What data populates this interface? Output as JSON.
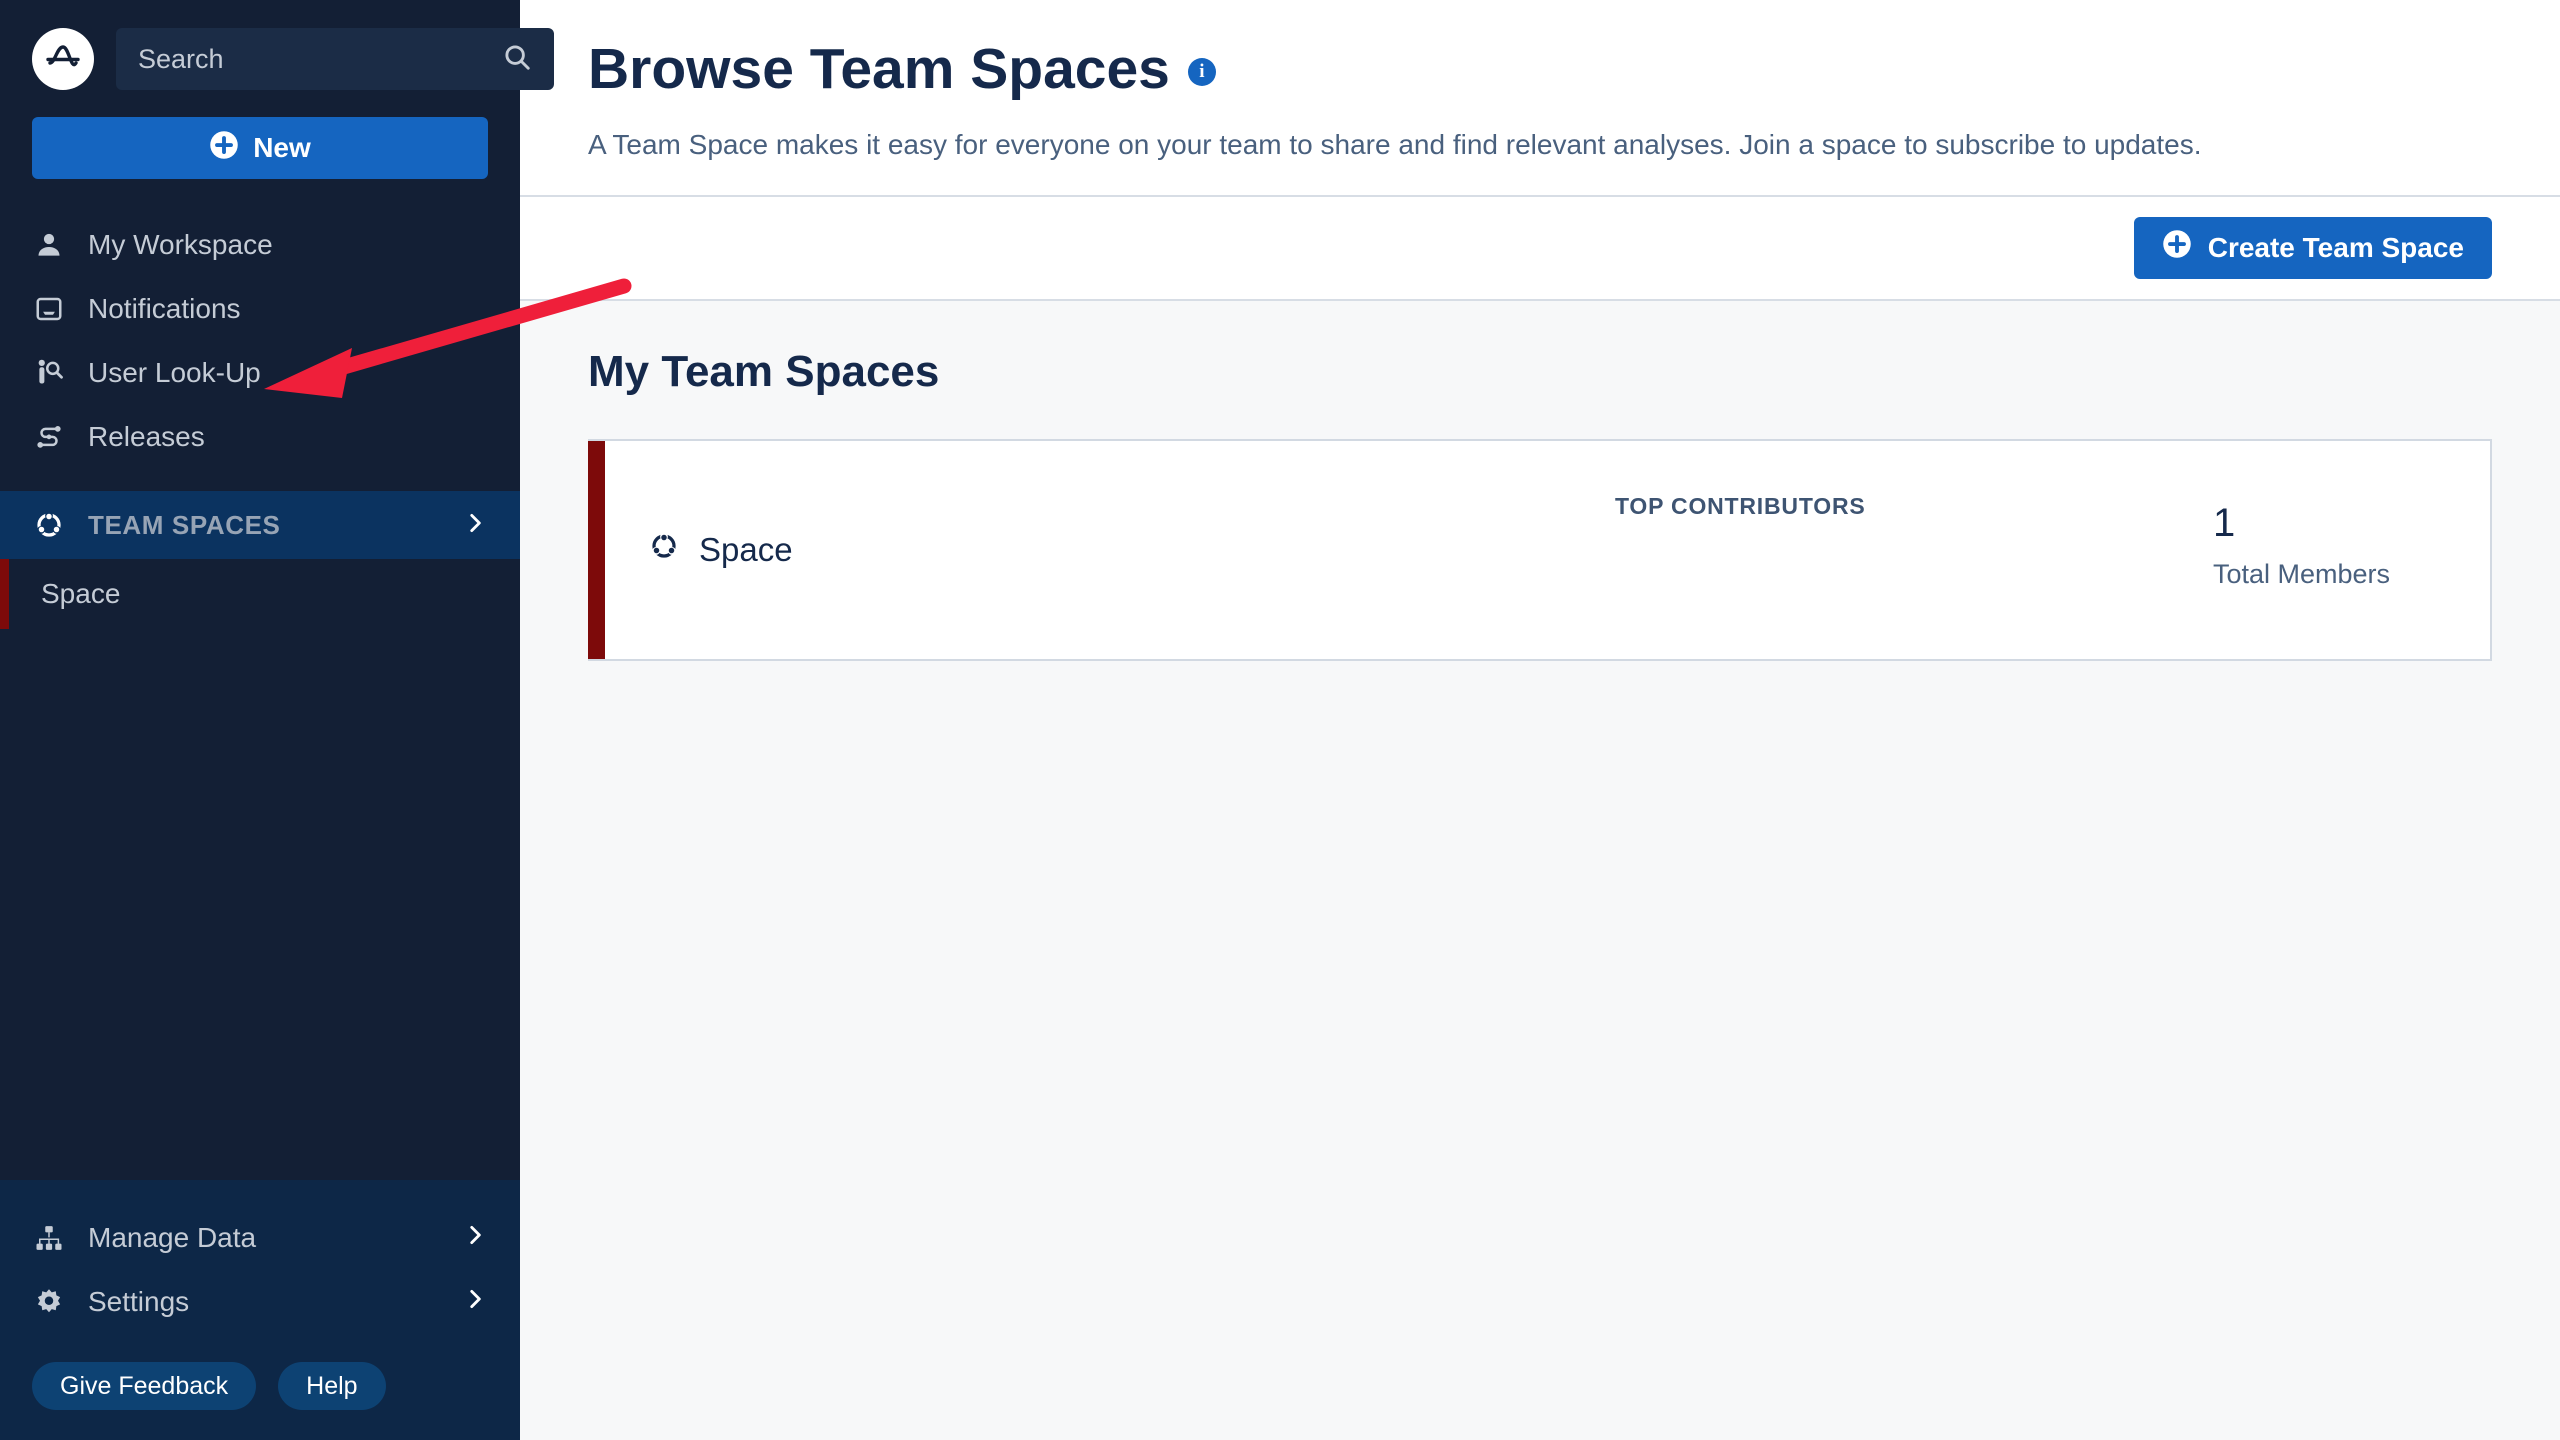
{
  "sidebar": {
    "logo_icon": "amplitude-logo-icon",
    "search": {
      "placeholder": "Search",
      "value": "",
      "icon": "search-icon"
    },
    "new_button": {
      "label": "New",
      "icon": "plus-circle-icon"
    },
    "nav_items": [
      {
        "label": "My Workspace",
        "icon": "person-icon"
      },
      {
        "label": "Notifications",
        "icon": "inbox-icon"
      },
      {
        "label": "User Look-Up",
        "icon": "person-search-icon"
      },
      {
        "label": "Releases",
        "icon": "releases-path-icon"
      }
    ],
    "team_spaces_section": {
      "label": "TEAM SPACES",
      "icon": "team-space-icon",
      "chevron": "chevron-right-icon",
      "items": [
        {
          "label": "Space"
        }
      ]
    },
    "bottom_items": [
      {
        "label": "Manage Data",
        "icon": "hierarchy-icon",
        "chevron": "chevron-right-icon"
      },
      {
        "label": "Settings",
        "icon": "gear-icon",
        "chevron": "chevron-right-icon"
      }
    ],
    "pills": [
      {
        "label": "Give Feedback"
      },
      {
        "label": "Help"
      }
    ]
  },
  "header": {
    "title": "Browse Team Spaces",
    "info_icon": "info-icon",
    "info_glyph": "i",
    "subtitle": "A Team Space makes it easy for everyone on your team to share and find relevant analyses. Join a space to subscribe to updates."
  },
  "toolbar": {
    "create_button": {
      "label": "Create Team Space",
      "icon": "plus-circle-icon"
    }
  },
  "main": {
    "section_title": "My Team Spaces",
    "spaces": [
      {
        "name": "Space",
        "icon": "team-space-icon",
        "contributors_label": "TOP CONTRIBUTORS",
        "members_count": "1",
        "members_label": "Total Members"
      }
    ]
  },
  "annotation": {
    "type": "arrow",
    "color": "#ef1f3a",
    "points": "from (628,283) to (265,388)"
  },
  "colors": {
    "sidebar_bg": "#131f35",
    "sidebar_bottom_bg": "#0d2747",
    "section_header_bg": "#0b3360",
    "accent_blue": "#1565C0",
    "accent_maroon": "#7d0a0a",
    "title_navy": "#15294b",
    "body_text": "#49607e",
    "page_bg": "#f7f8f9"
  }
}
